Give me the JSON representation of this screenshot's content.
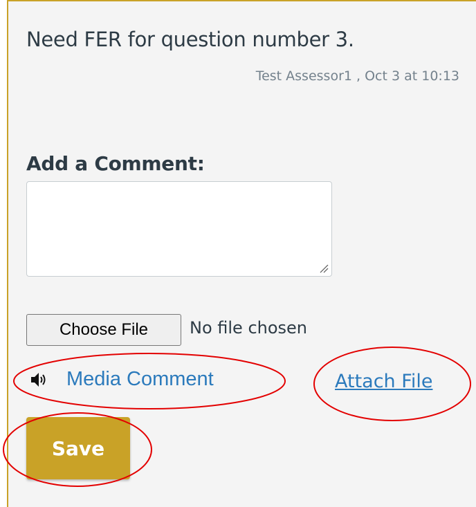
{
  "comment": {
    "text": "Need FER for question number 3.",
    "meta": "Test Assessor1 , Oct 3 at 10:13"
  },
  "form": {
    "add_label": "Add a Comment:",
    "textarea_value": "",
    "choose_file_label": "Choose File",
    "no_file_text": "No file chosen",
    "media_comment_label": "Media Comment",
    "attach_file_label": "Attach File",
    "save_label": "Save"
  },
  "icons": {
    "media": "speaker-icon",
    "resize": "resize-grip-icon"
  },
  "colors": {
    "accent": "#c9a227",
    "link": "#2b7abc",
    "annotation": "#e30000",
    "panel_bg": "#f4f4f4"
  }
}
